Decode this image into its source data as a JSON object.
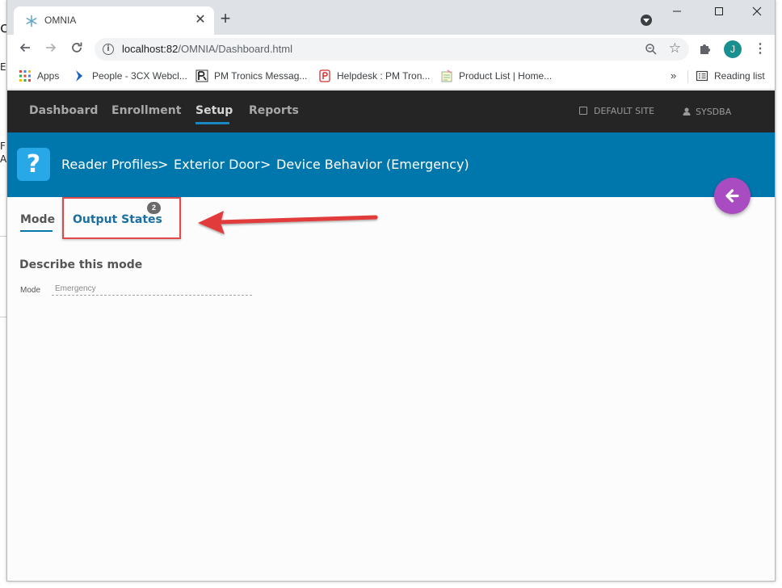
{
  "background_fragments": [
    "c",
    "E",
    "F",
    "A"
  ],
  "browser": {
    "tab_title": "OMNIA",
    "tab_favicon": "snowflake-icon",
    "url_host": "localhost:82",
    "url_path": "/OMNIA/Dashboard.html",
    "profile_initial": "J",
    "window_controls": [
      "minimize",
      "maximize",
      "close"
    ]
  },
  "bookmarks": {
    "items": [
      {
        "label": "Apps",
        "icon": "apps-grid-icon"
      },
      {
        "label": "People - 3CX Webcl...",
        "icon": "3cx-icon"
      },
      {
        "label": "PM Tronics Messag...",
        "icon": "pmtronics-icon"
      },
      {
        "label": "Helpdesk : PM Tron...",
        "icon": "helpdesk-icon"
      },
      {
        "label": "Product List | Home...",
        "icon": "product-list-icon"
      }
    ],
    "overflow": "»",
    "reading_list": "Reading list"
  },
  "nav": {
    "items": [
      "Dashboard",
      "Enrollment",
      "Setup",
      "Reports"
    ],
    "active": "Setup",
    "site": "DEFAULT SITE",
    "user": "SYSDBA"
  },
  "header": {
    "help_icon": "?",
    "breadcrumb": [
      "Reader Profiles",
      "Exterior Door",
      "Device Behavior (Emergency)"
    ],
    "separator": ">"
  },
  "content": {
    "tabs": [
      {
        "label": "Mode",
        "active": true
      },
      {
        "label": "Output States",
        "active": false,
        "badge": "2"
      }
    ],
    "section_title": "Describe this mode",
    "mode_field": {
      "label": "Mode",
      "value": "Emergency"
    }
  },
  "colors": {
    "nav_bg": "#252525",
    "header_bg": "#0077ac",
    "fab": "#a94cc1",
    "highlight": "#e24a4a"
  }
}
